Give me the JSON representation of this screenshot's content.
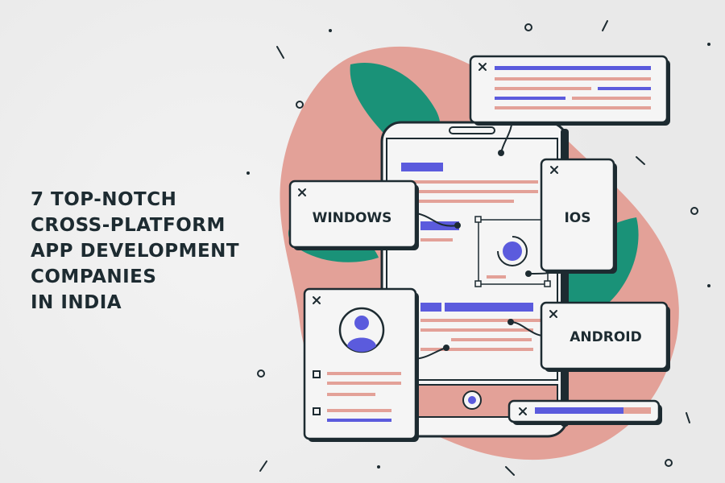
{
  "headline": {
    "line1": "7 TOP-NOTCH",
    "line2": "CROSS-PLATFORM",
    "line3": "APP DEVELOPMENT",
    "line4": "COMPANIES",
    "line5": "IN INDIA"
  },
  "cards": {
    "windows": "WINDOWS",
    "ios": "IOS",
    "android": "ANDROID"
  },
  "colors": {
    "background": "#ececec",
    "blob": "#e3a198",
    "leaf": "#1a9278",
    "accent": "#5b5bdd",
    "outline": "#1d2b31",
    "card": "#f5f5f5",
    "pink_line": "#e3a198"
  },
  "icons": [
    "close-icon",
    "avatar-icon",
    "checkbox-icon",
    "target-icon",
    "home-button-icon"
  ]
}
